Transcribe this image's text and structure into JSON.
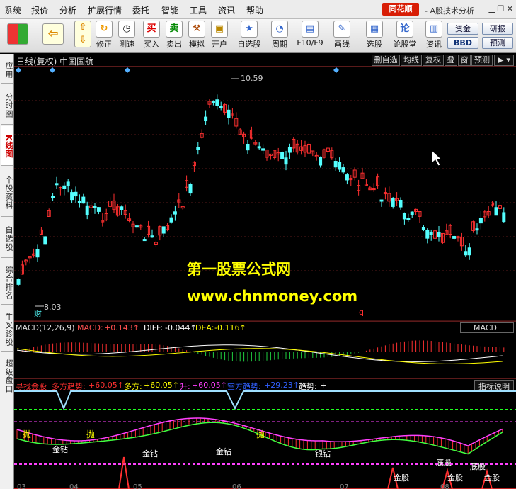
{
  "menu": [
    "系统",
    "报价",
    "分析",
    "扩展行情",
    "委托",
    "智能",
    "工具",
    "资讯",
    "帮助"
  ],
  "brand": {
    "logo": "同花顺",
    "subtitle": "- A股技术分析"
  },
  "toolbar": [
    {
      "label": "",
      "icon": "windows-logo-icon"
    },
    {
      "label": "",
      "icon": "back-arrow-icon"
    },
    {
      "label": "",
      "icon": "up-down-arrow-icon"
    },
    {
      "label": "修正",
      "icon": "refresh-icon"
    },
    {
      "label": "测速",
      "icon": "clock-icon"
    },
    {
      "label": "买入",
      "icon": "buy-icon",
      "glyph": "买"
    },
    {
      "label": "卖出",
      "icon": "sell-icon",
      "glyph": "卖"
    },
    {
      "label": "模拟",
      "icon": "hammer-icon"
    },
    {
      "label": "开户",
      "icon": "lock-icon"
    },
    {
      "label": "自选股",
      "icon": "star-icon"
    },
    {
      "label": "周期",
      "icon": "cycle-icon"
    },
    {
      "label": "F10/F9",
      "icon": "f10-icon"
    },
    {
      "label": "画线",
      "icon": "pen-icon"
    },
    {
      "label": "选股",
      "icon": "select-stock-icon"
    },
    {
      "label": "论股堂",
      "icon": "forum-icon",
      "glyph": "论"
    },
    {
      "label": "资讯",
      "icon": "news-icon"
    }
  ],
  "side_buttons": [
    "资金",
    "研报",
    "BBD",
    "预测"
  ],
  "sidebar": [
    "应用",
    "分时图",
    "K线图",
    "个股资料",
    "自选股",
    "综合排名",
    "牛叉诊股",
    "超级盘口"
  ],
  "chart_header": {
    "title": "日线(复权)  中国国航",
    "buttons": [
      "删自选",
      "均线",
      "复权",
      "叠",
      "窗",
      "预测"
    ]
  },
  "price_labels": {
    "high": "10.59",
    "low": "8.03",
    "mark_cai": "财",
    "mark_q": "q"
  },
  "watermark": {
    "line1": "第一股票公式网",
    "line2": "www.chnmoney.com"
  },
  "macd": {
    "name": "MACD(12,26,9)",
    "macd_label": "MACD:",
    "macd_value": "+0.143↑",
    "diff_label": "DIFF:",
    "diff_value": "-0.044↑",
    "dea_label": "DEA:",
    "dea_value": "-0.116↑",
    "selector": "MACD"
  },
  "indicator": {
    "name": "寻找金股",
    "items": [
      {
        "label": "多方趋势:",
        "value": "+60.05↑"
      },
      {
        "label": "多方:",
        "value": "+60.05↑"
      },
      {
        "label": "升:",
        "value": "+60.05↑"
      },
      {
        "label": "空方趋势:",
        "value": "+29.23↑"
      },
      {
        "label": "趋势:",
        "value": "+"
      }
    ],
    "help": "指标说明"
  },
  "signals": {
    "pao": "抛",
    "jinzuan": "金钻",
    "yinzuan": "银钻",
    "jingu": "金股",
    "digu": "底股"
  },
  "months": [
    "03",
    "04",
    "05",
    "06",
    "07",
    "08"
  ],
  "colors": {
    "up": "#ff3030",
    "down": "#54ffff",
    "accent": "#d81e06"
  }
}
